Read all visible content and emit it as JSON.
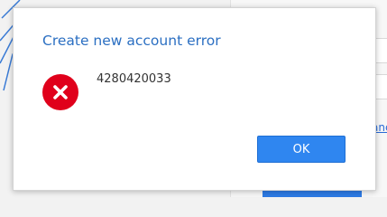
{
  "dialog": {
    "title": "Create new account error",
    "message": "4280420033",
    "icon": "error-icon",
    "ok_label": "OK"
  },
  "background": {
    "link_fragment": "anc"
  },
  "colors": {
    "title": "#2b6fc2",
    "error_icon": "#e0001b",
    "ok_button": "#2f86f0"
  }
}
